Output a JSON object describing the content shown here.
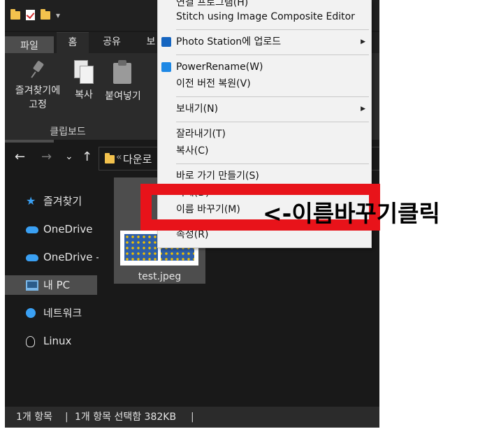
{
  "titlebar": {
    "icons": [
      "folder-icon",
      "checkmark-doc-icon",
      "folder-icon",
      "dropdown-icon"
    ],
    "qat_dropdown": "▾"
  },
  "tabs": [
    {
      "label": "파일"
    },
    {
      "label": "홈"
    },
    {
      "label": "공유"
    },
    {
      "label": "보"
    }
  ],
  "ribbon": {
    "pin_label_line1": "즐겨찾기에",
    "pin_label_line2": "고정",
    "copy_label": "복사",
    "paste_label": "붙여넣기",
    "group_label": "클립보드"
  },
  "address_bar": {
    "back": "←",
    "forward": "→",
    "recent": "⌄",
    "up": "↑",
    "chevron": "«",
    "path": "다운로"
  },
  "sidebar": {
    "items": [
      {
        "label": "즐겨찾기",
        "icon": "star-icon",
        "selected": false
      },
      {
        "label": "OneDrive",
        "icon": "cloud-icon",
        "selected": false
      },
      {
        "label": "OneDrive -",
        "icon": "cloud-icon",
        "selected": false
      },
      {
        "label": "내 PC",
        "icon": "pc-icon",
        "selected": true
      },
      {
        "label": "네트워크",
        "icon": "network-icon",
        "selected": false
      },
      {
        "label": "Linux",
        "icon": "linux-icon",
        "selected": false
      }
    ]
  },
  "files": [
    {
      "name": "test.jpeg",
      "selected": true
    }
  ],
  "status_bar": {
    "count": "1개 항목",
    "selection": "1개 항목 선택함 382KB"
  },
  "context_menu": {
    "items": [
      {
        "label": "연결 프로그램(H)",
        "arrow": false
      },
      {
        "label": "Stitch using Image Composite Editor",
        "arrow": false
      },
      {
        "label": "Photo Station에 업로드",
        "arrow": true,
        "icon": "photo-station-icon"
      },
      {
        "label": "PowerRename(W)",
        "arrow": false,
        "icon": "powerrename-icon"
      },
      {
        "label": "이전 버전 복원(V)",
        "arrow": false
      },
      {
        "label": "보내기(N)",
        "arrow": true
      },
      {
        "label": "잘라내기(T)",
        "arrow": false
      },
      {
        "label": "복사(C)",
        "arrow": false
      },
      {
        "label": "바로 가기 만들기(S)",
        "arrow": false
      },
      {
        "label": "삭제(D)",
        "arrow": false
      },
      {
        "label": "이름 바꾸기(M)",
        "arrow": false
      },
      {
        "label": "속성(R)",
        "arrow": false
      }
    ],
    "submenu_arrow": "▶"
  },
  "annotation": {
    "text": "<-이름바꾸기클릭",
    "color": "#e8131a"
  }
}
